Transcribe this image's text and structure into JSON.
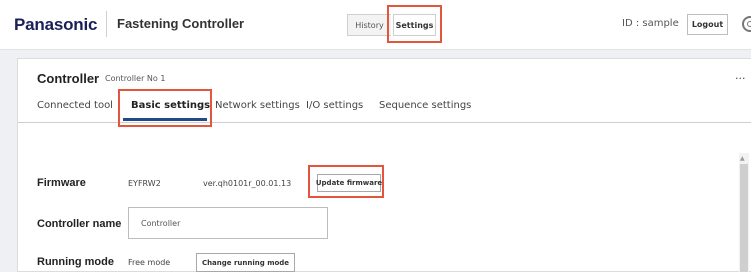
{
  "header": {
    "brand": "Panasonic",
    "app_title": "Fastening Controller",
    "history_label": "History",
    "settings_label": "Settings",
    "user_id": "ID : sample",
    "logout_label": "Logout"
  },
  "controller": {
    "title": "Controller",
    "subtitle": "Controller No 1",
    "more_label": "..."
  },
  "tabs": [
    {
      "label": "Connected tool",
      "active": false
    },
    {
      "label": "Basic settings",
      "active": true
    },
    {
      "label": "Network settings",
      "active": false
    },
    {
      "label": "I/O settings",
      "active": false
    },
    {
      "label": "Sequence settings",
      "active": false
    }
  ],
  "firmware": {
    "label": "Firmware",
    "model": "EYFRW2",
    "version": "ver.qh0101r_00.01.13",
    "update_button": "Update firmware"
  },
  "controller_name": {
    "label": "Controller name",
    "value": "Controller"
  },
  "running_mode": {
    "label": "Running mode",
    "value": "Free mode",
    "change_button": "Change running mode"
  },
  "colors": {
    "highlight": "#e4553e",
    "tab_underline": "#234a86",
    "brand": "#1a1f5a"
  }
}
